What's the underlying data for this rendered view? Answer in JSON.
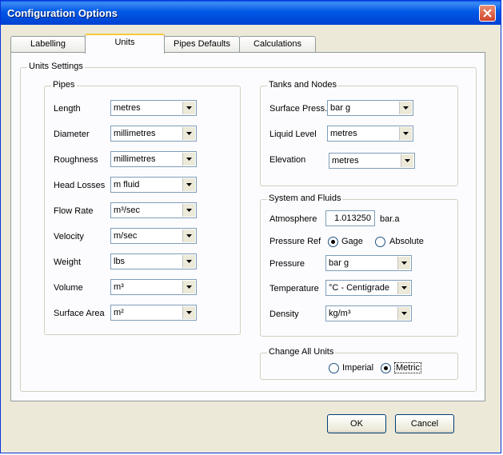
{
  "window": {
    "title": "Configuration Options"
  },
  "tabs": [
    "Labelling",
    "Units",
    "Pipes Defaults",
    "Calculations"
  ],
  "units_settings": {
    "legend": "Units Settings"
  },
  "pipes": {
    "legend": "Pipes",
    "rows": [
      {
        "label": "Length",
        "value": "metres"
      },
      {
        "label": "Diameter",
        "value": "millimetres"
      },
      {
        "label": "Roughness",
        "value": "millimetres"
      },
      {
        "label": "Head Losses",
        "value": "m fluid"
      },
      {
        "label": "Flow Rate",
        "value": "m³/sec"
      },
      {
        "label": "Velocity",
        "value": "m/sec"
      },
      {
        "label": "Weight",
        "value": "lbs"
      },
      {
        "label": "Volume",
        "value": "m³"
      },
      {
        "label": "Surface Area",
        "value": "m²"
      }
    ]
  },
  "tanks": {
    "legend": "Tanks and Nodes",
    "rows": [
      {
        "label": "Surface Press.",
        "value": "bar g"
      },
      {
        "label": "Liquid Level",
        "value": "metres"
      },
      {
        "label": "Elevation",
        "value": "metres"
      }
    ]
  },
  "system": {
    "legend": "System and Fluids",
    "atmosphere_label": "Atmosphere",
    "atmosphere_value": "1.013250",
    "atmosphere_unit": "bar.a",
    "pressure_ref_label": "Pressure Ref",
    "gage_label": "Gage",
    "absolute_label": "Absolute",
    "pressure_ref_selected": "Gage",
    "pressure_label": "Pressure",
    "pressure_value": "bar g",
    "temperature_label": "Temperature",
    "temperature_value": "°C - Centigrade",
    "density_label": "Density",
    "density_value": "kg/m³"
  },
  "change_all": {
    "legend": "Change All Units",
    "imperial_label": "Imperial",
    "metric_label": "Metric",
    "selected": "Metric"
  },
  "buttons": {
    "ok": "OK",
    "cancel": "Cancel"
  },
  "colors": {
    "title_bar": "#0054e3",
    "close_button": "#d2442a",
    "dialog_bg": "#ece9d8",
    "tab_highlight": "#ffc83c"
  }
}
